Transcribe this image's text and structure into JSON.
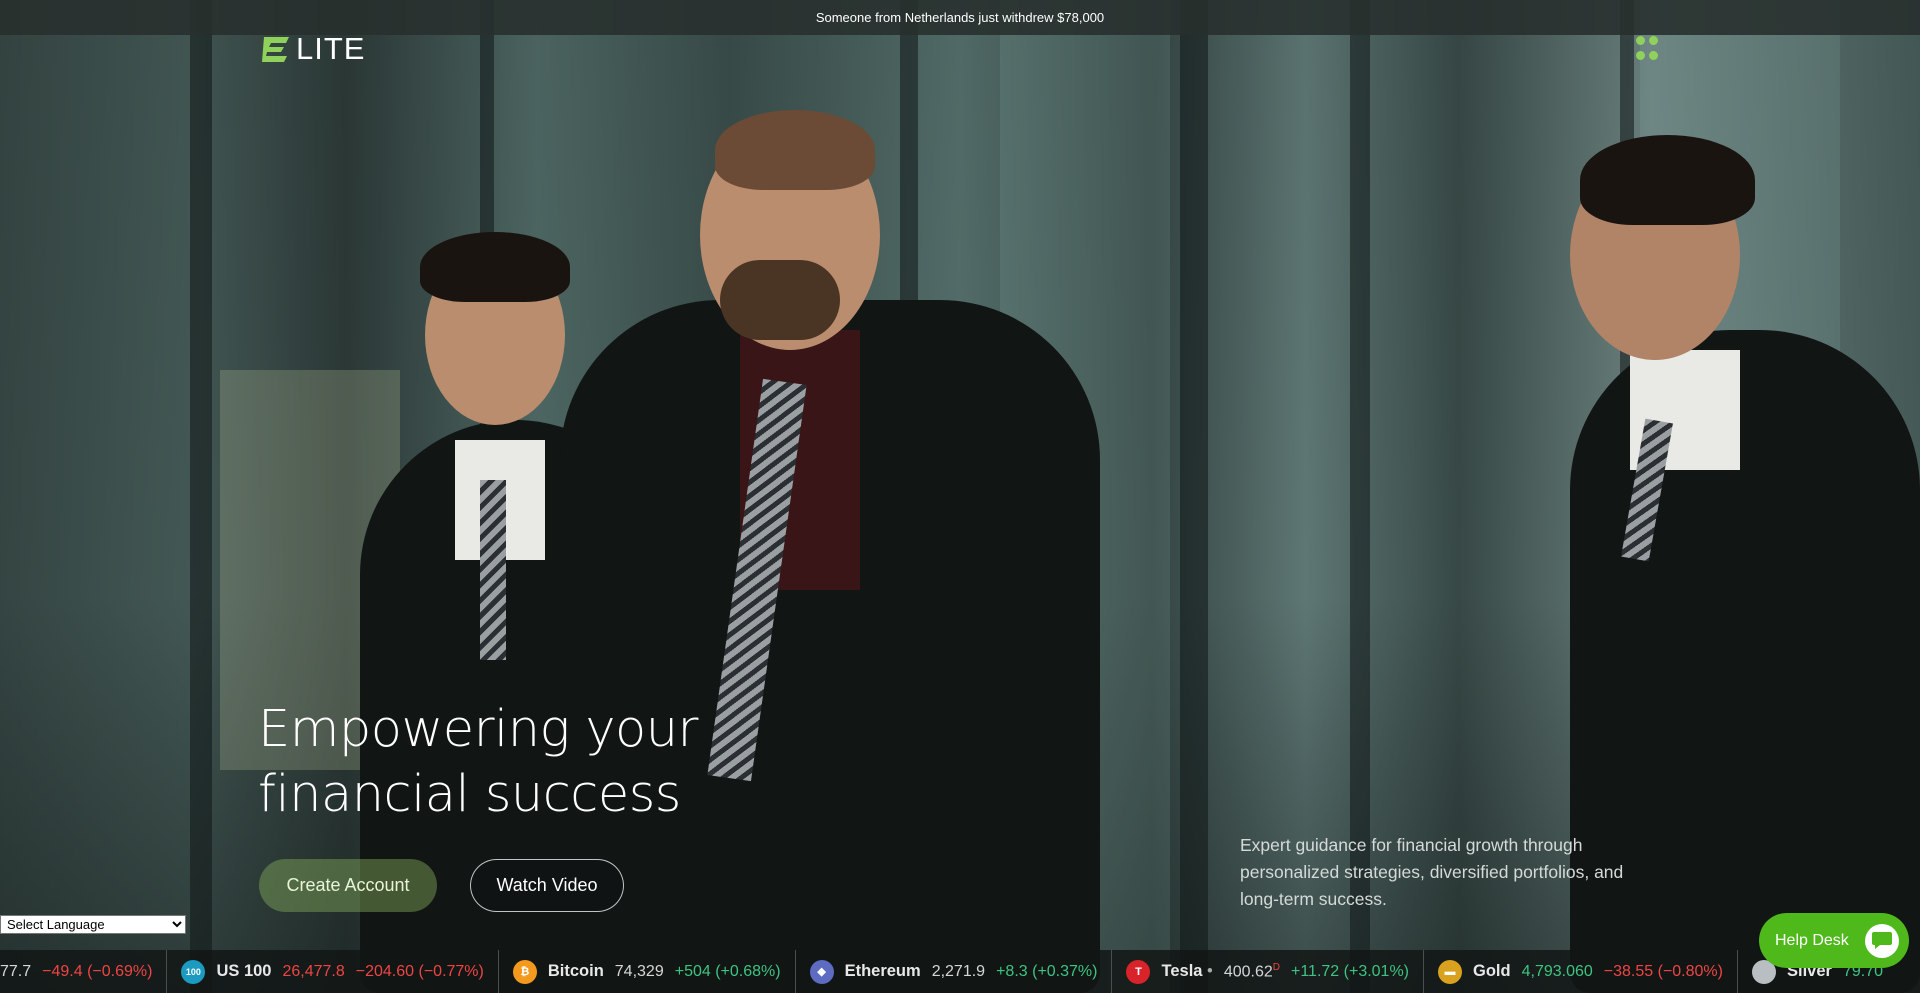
{
  "announcement": "Someone from Netherlands just withdrew $78,000",
  "brand": {
    "logo_text": "LITE",
    "accent": "#8fd15a"
  },
  "hero": {
    "headline_line1": "Empowering your",
    "headline_line2": "financial success",
    "primary_cta": "Create Account",
    "secondary_cta": "Watch Video",
    "tagline": "Expert guidance for financial growth through personalized strategies, diversified portfolios, and long-term success."
  },
  "language_select": {
    "selected": "Select Language"
  },
  "ticker": [
    {
      "name": "",
      "price": "77.7",
      "change": "−49.4 (−0.69%)",
      "direction": "down",
      "icon": "",
      "color": ""
    },
    {
      "name": "US 100",
      "price": "26,477.8",
      "change": "−204.60 (−0.77%)",
      "direction": "down",
      "icon": "100",
      "color": "#1a9bbf"
    },
    {
      "name": "Bitcoin",
      "price": "74,329",
      "change": "+504 (+0.68%)",
      "direction": "up",
      "icon": "₿",
      "color": "#f39a1e"
    },
    {
      "name": "Ethereum",
      "price": "2,271.9",
      "change": "+8.3 (+0.37%)",
      "direction": "up",
      "icon": "◆",
      "color": "#5d6bc0"
    },
    {
      "name": "Tesla",
      "price": "400.62",
      "change": "+11.72 (+3.01%)",
      "direction": "up",
      "icon": "T",
      "color": "#d8232a",
      "price_suffix": "D",
      "name_suffix": "•"
    },
    {
      "name": "Gold",
      "price": "4,793.060",
      "change": "−38.55 (−0.80%)",
      "direction": "down",
      "icon": "▬",
      "color": "#d9a21e"
    },
    {
      "name": "Silver",
      "price": "79.70",
      "change": "",
      "direction": "up",
      "icon": "",
      "color": "#b9bec2"
    }
  ],
  "help_desk": {
    "label": "Help Desk"
  }
}
